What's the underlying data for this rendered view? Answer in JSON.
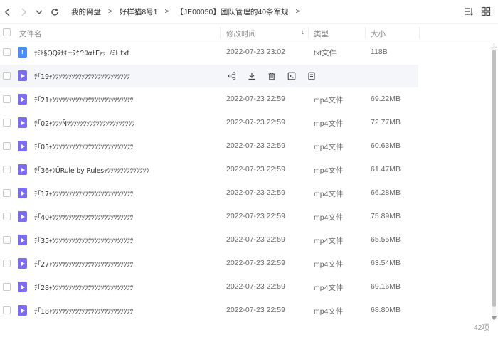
{
  "breadcrumb": [
    "我的网盘",
    "好样猫8号1",
    "【JE00050】团队管理的40条军规"
  ],
  "columns": {
    "name": "文件名",
    "time": "修改时间",
    "type": "类型",
    "size": "大小"
  },
  "files": [
    {
      "icon": "T",
      "kind": "txt",
      "name": "ﾅﾐﾄ§QQﾇﾅｷ±ﾇｹ^ﾕαﾄΓｬｯｰﾉﾐﾄ.txt",
      "time": "2022-07-23 23:02",
      "type": "txt文件",
      "size": "118B"
    },
    {
      "icon": "",
      "kind": "video",
      "name": "ﾁ｢19ｬﾂﾂﾂﾂﾂﾂﾂﾂﾂﾂﾂﾂﾂﾂﾂﾂﾂﾂﾂﾂﾂﾂﾂﾂ",
      "time": "",
      "type": "",
      "size": ""
    },
    {
      "icon": "",
      "kind": "video",
      "name": "ﾁ｢21ｬﾂﾂﾂﾂﾂﾂﾂﾂﾂﾂﾂﾂﾂﾂﾂﾂﾂﾂﾂﾂﾂﾂﾂﾂﾂ",
      "time": "2022-07-23 22:59",
      "type": "mp4文件",
      "size": "69.22MB"
    },
    {
      "icon": "",
      "kind": "video",
      "name": "ﾁ｢02ｬﾂﾂﾂÑﾂﾂﾂﾂﾂﾂﾂﾂﾂﾂﾂﾂﾂﾂﾂﾂﾂﾂﾂﾂﾂ",
      "time": "2022-07-23 22:59",
      "type": "mp4文件",
      "size": "72.77MB"
    },
    {
      "icon": "",
      "kind": "video",
      "name": "ﾁ｢05ｬﾂﾂﾂﾂﾂﾂﾂﾂﾂﾂﾂﾂﾂﾂﾂﾂﾂﾂﾂﾂﾂﾂﾂﾂﾂ",
      "time": "2022-07-23 22:59",
      "type": "mp4文件",
      "size": "60.63MB"
    },
    {
      "icon": "",
      "kind": "video",
      "name": "ﾁ｢36ｬﾂÛRule by Rulesｬﾂﾂﾂﾂﾂﾂﾂﾂﾂﾂﾂﾂﾂ",
      "time": "2022-07-23 22:59",
      "type": "mp4文件",
      "size": "61.47MB"
    },
    {
      "icon": "",
      "kind": "video",
      "name": "ﾁ｢17ｬﾂﾂﾂﾂﾂﾂﾂﾂﾂﾂﾂﾂﾂﾂﾂﾂﾂﾂﾂﾂﾂﾂﾂﾂﾂ",
      "time": "2022-07-23 22:59",
      "type": "mp4文件",
      "size": "66.28MB"
    },
    {
      "icon": "",
      "kind": "video",
      "name": "ﾁ｢40ｬﾂﾂﾂﾂﾂﾂﾂﾂﾂﾂﾂﾂﾂﾂﾂﾂﾂﾂﾂﾂﾂﾂﾂﾂﾂ",
      "time": "2022-07-23 22:59",
      "type": "mp4文件",
      "size": "75.89MB"
    },
    {
      "icon": "",
      "kind": "video",
      "name": "ﾁ｢35ｬﾂﾂﾂﾂﾂﾂﾂﾂﾂﾂﾂﾂﾂﾂﾂﾂﾂﾂﾂﾂﾂﾂﾂﾂﾂ",
      "time": "2022-07-23 22:59",
      "type": "mp4文件",
      "size": "65.55MB"
    },
    {
      "icon": "",
      "kind": "video",
      "name": "ﾁ｢27ｬﾂﾂﾂﾂﾂﾂﾂﾂﾂﾂﾂﾂﾂﾂﾂﾂﾂﾂﾂﾂﾂﾂﾂﾂﾂ",
      "time": "2022-07-23 22:59",
      "type": "mp4文件",
      "size": "63.54MB"
    },
    {
      "icon": "",
      "kind": "video",
      "name": "ﾁ｢28ｬﾂﾂﾂﾂﾂﾂﾂﾂﾂﾂﾂﾂﾂﾂﾂﾂﾂﾂﾂﾂﾂﾂﾂﾂﾂ",
      "time": "2022-07-23 22:59",
      "type": "mp4文件",
      "size": "69.16MB"
    },
    {
      "icon": "",
      "kind": "video",
      "name": "ﾁ｢18ｬﾂﾂﾂﾂﾂﾂﾂﾂﾂﾂﾂﾂﾂﾂﾂﾂﾂﾂﾂﾂﾂﾂﾂﾂﾂ",
      "time": "2022-07-23 22:59",
      "type": "mp4文件",
      "size": "68.80MB"
    }
  ],
  "hover_actions": [
    "share-icon",
    "download-icon",
    "delete-icon",
    "rename-icon",
    "more-icon"
  ],
  "footer": {
    "count": "42项"
  },
  "colors": {
    "accent": "#3b7df0",
    "txt_icon": "#4a8ef0",
    "video_icon": "#7b6cf0",
    "hover_row": "#f5f6f9"
  }
}
